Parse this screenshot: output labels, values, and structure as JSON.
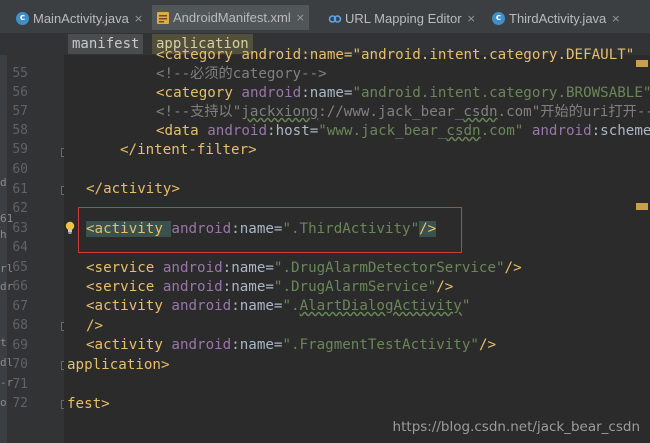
{
  "tabs": [
    {
      "label": "MainActivity.java",
      "icon": "java-class-icon",
      "active": false
    },
    {
      "label": "AndroidManifest.xml",
      "icon": "manifest-xml-icon",
      "active": true
    },
    {
      "label": "URL Mapping Editor",
      "icon": "url-link-icon",
      "active": false
    },
    {
      "label": "ThirdActivity.java",
      "icon": "java-class-icon",
      "active": false
    }
  ],
  "breadcrumb": [
    "manifest",
    "application"
  ],
  "line_numbers": [
    "55",
    "56",
    "57",
    "58",
    "59",
    "60",
    "61",
    "62",
    "63",
    "64",
    "65",
    "66",
    "67",
    "68",
    "69",
    "70",
    "71",
    "72"
  ],
  "code": {
    "l54": "<category android:name=\"android.intent.category.DEFAULT\"",
    "l55": "<!--必须的category-->",
    "l56a": "<category ",
    "l56b": "android",
    "l56c": ":name=",
    "l56d": "\"android.intent.category.BROWSABLE\"",
    "l57a": "<!--支持以\"",
    "l57b": "jackxiong",
    "l57c": "://www.jack_bear_",
    "l57d": "csdn",
    "l57e": ".com\"开始的uri打开-->",
    "l58a": "<data ",
    "l58b": "android",
    "l58c": ":host=",
    "l58d": "\"www.jack_bear_",
    "l58e": "csdn",
    "l58f": ".com\" ",
    "l58g": "android",
    "l58h": ":scheme",
    "l59": "</intent-filter>",
    "l61": "</activity>",
    "l63a": "<activity ",
    "l63b": "android",
    "l63c": ":name=",
    "l63d": "\".ThirdActivity\"",
    "l63e": "/>",
    "l65a": "<service ",
    "l65b": "android",
    "l65c": ":name=",
    "l65d": "\".DrugAlarmDetectorService\"",
    "l65e": "/>",
    "l66a": "<service ",
    "l66b": "android",
    "l66c": ":name=",
    "l66d": "\".DrugAlarmService\"",
    "l66e": "/>",
    "l67a": "<activity ",
    "l67b": "android",
    "l67c": ":name=",
    "l67d": "\".",
    "l67e": "AlartDialogActivity",
    "l67f": "\"",
    "l68": "/>",
    "l69a": "<activity ",
    "l69b": "android",
    "l69c": ":name=",
    "l69d": "\".FragmentTestActivity\"",
    "l69e": "/>",
    "l70": "application>",
    "l72": "fest>"
  },
  "edge_chars": [
    "d",
    "61",
    "h",
    "rl",
    "dr",
    "t",
    "dl",
    "-r",
    "o"
  ],
  "watermark": "https://blog.csdn.net/jack_bear_csdn",
  "colors": {
    "tag": "#e8bf6a",
    "attr": "#9876aa",
    "string": "#6a8759",
    "comment": "#808080",
    "redbox": "#d23b3b"
  }
}
